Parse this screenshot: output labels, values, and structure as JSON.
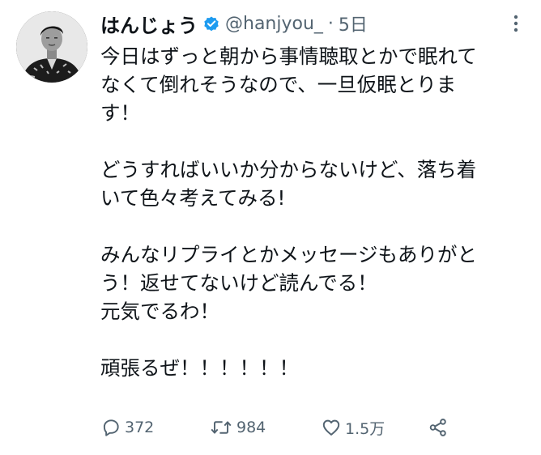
{
  "tweet": {
    "author": {
      "display_name": "はんじょう",
      "handle": "@hanjyou_",
      "verified": true,
      "separator": "·",
      "time": "5日"
    },
    "lines": [
      "今日はずっと朝から事情聴取とかで眠れて",
      "なくて倒れそうなので、一旦仮眠とりま",
      "す！",
      "",
      "どうすればいいか分からないけど、落ち着",
      "いて色々考えてみる!",
      "",
      "みんなリプライとかメッセージもありがと",
      "う！返せてないけど読んでる！",
      "元気でるわ！",
      "",
      "頑張るぜ！！！！！！"
    ],
    "actions": {
      "reply": {
        "icon": "reply-icon",
        "count": "372"
      },
      "retweet": {
        "icon": "retweet-icon",
        "count": "984"
      },
      "like": {
        "icon": "heart-icon",
        "count": "1.5万"
      },
      "share": {
        "icon": "share-icon",
        "count": ""
      }
    },
    "colors": {
      "text": "#0f1419",
      "secondary": "#536471",
      "verified": "#1d9bf0"
    }
  }
}
